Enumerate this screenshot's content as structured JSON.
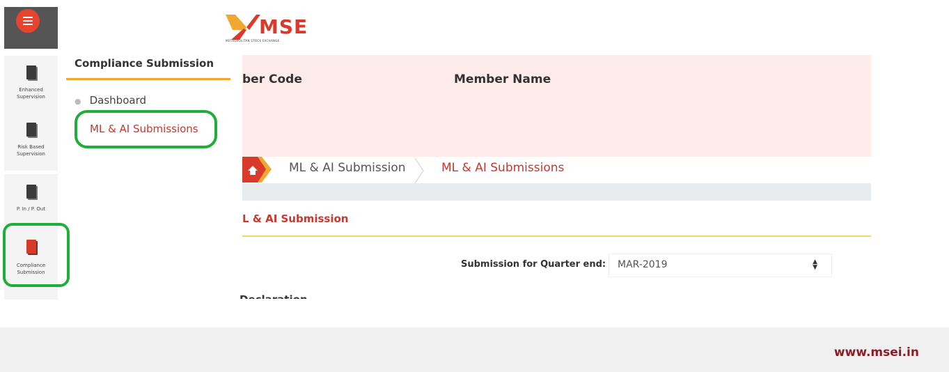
{
  "logo": {
    "text": "MSE",
    "subtitle": "METROPOLITAN STOCK EXCHANGE"
  },
  "rail": {
    "items": [
      {
        "label": "Enhanced Supervision"
      },
      {
        "label": "Risk Based Supervision"
      },
      {
        "label": "P. In / P. Out"
      },
      {
        "label": "Compliance Submission"
      }
    ]
  },
  "submenu": {
    "title": "Compliance Submission",
    "items": [
      {
        "label": "Dashboard"
      },
      {
        "label": "ML & AI Submissions"
      }
    ]
  },
  "member_header": {
    "code_label": "ber Code",
    "name_label": "Member Name"
  },
  "breadcrumb": {
    "items": [
      "ML & AI Submission",
      "ML & AI Submissions"
    ]
  },
  "section": {
    "title": "L & AI Submission"
  },
  "form": {
    "quarter_label": "Submission for Quarter end:",
    "quarter_value": "MAR-2019",
    "partial_text": "Declaration"
  },
  "footer": {
    "url": "www.msei.in"
  },
  "colors": {
    "brand_red": "#d93a2b",
    "highlight_green": "#1fae3a",
    "header_pink": "#fdecea",
    "footer_url": "#8b1f28"
  }
}
